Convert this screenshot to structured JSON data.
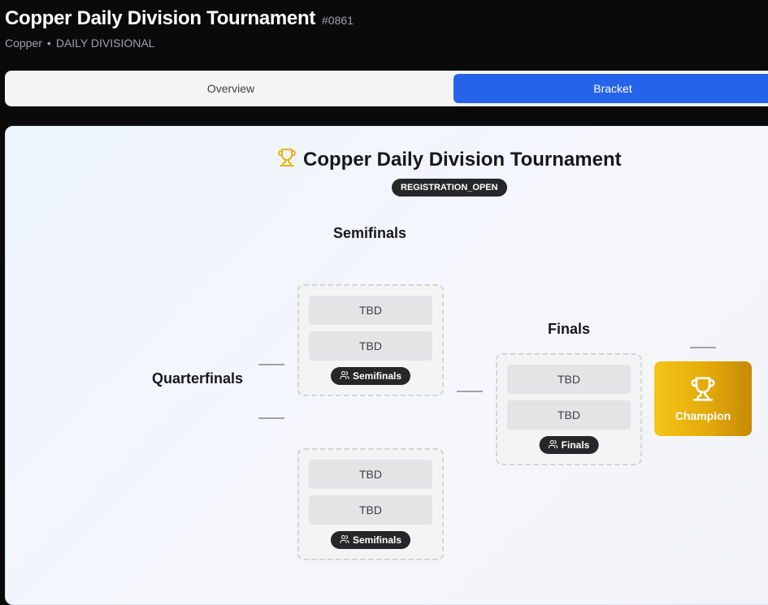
{
  "header": {
    "title": "Copper Daily Division Tournament",
    "id": "#0861",
    "tier": "Copper",
    "separator": "•",
    "type": "DAILY DIVISIONAL"
  },
  "tabs": [
    {
      "label": "Overview",
      "active": false
    },
    {
      "label": "Bracket",
      "active": true
    }
  ],
  "bracket": {
    "title": "Copper Daily Division Tournament",
    "status": "REGISTRATION_OPEN",
    "rounds": {
      "quarterfinals": "Quarterfinals",
      "semifinals": "Semifinals",
      "finals": "Finals"
    },
    "matches": [
      {
        "slot1": "TBD",
        "slot2": "TBD",
        "badge": "Semifinals"
      },
      {
        "slot1": "TBD",
        "slot2": "TBD",
        "badge": "Semifinals"
      },
      {
        "slot1": "TBD",
        "slot2": "TBD",
        "badge": "Finals"
      }
    ],
    "champion": "Champion"
  },
  "colors": {
    "accent": "#2563eb",
    "trophy": "#eab308",
    "champion_gradient": [
      "#f5c518",
      "#c68a06"
    ]
  },
  "icons": {
    "title_icon": "trophy-icon",
    "match_badge_icon": "users-icon",
    "champion_icon": "trophy-icon"
  }
}
